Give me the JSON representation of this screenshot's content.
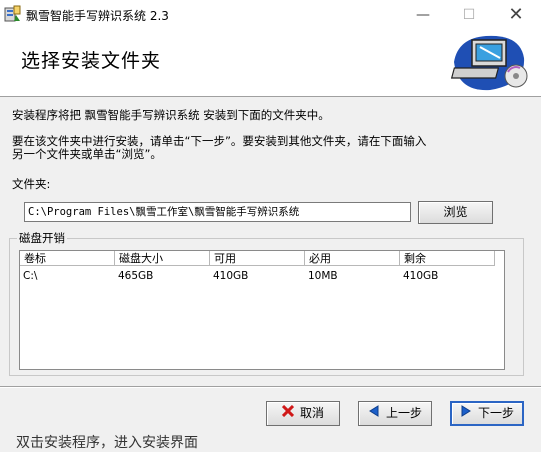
{
  "window": {
    "title": "飘雪智能手写辨识系统 2.3"
  },
  "header": {
    "title": "选择安装文件夹"
  },
  "description": {
    "line1": "安装程序将把 飘雪智能手写辨识系统 安装到下面的文件夹中。",
    "line2": "要在该文件夹中进行安装，请单击“下一步”。要安装到其他文件夹，请在下面输入",
    "line3": "另一个文件夹或单击“浏览”。"
  },
  "folder": {
    "label": "文件夹:",
    "path": "C:\\Program Files\\飘雪工作室\\飘雪智能手写辨识系统",
    "browse_label": "浏览"
  },
  "disk": {
    "group_label": "磁盘开销",
    "columns": [
      "卷标",
      "磁盘大小",
      "可用",
      "必用",
      "剩余"
    ],
    "rows": [
      [
        "C:\\",
        "465GB",
        "410GB",
        "10MB",
        "410GB"
      ]
    ]
  },
  "buttons": {
    "cancel": "取消",
    "back": "上一步",
    "next": "下一步"
  },
  "overflow_text": "双击安装程序，进入安装界面",
  "colors": {
    "cancel_icon": "#d01818",
    "nav_icon": "#1c5fc9",
    "dialog_bg": "#f0f0f0"
  }
}
